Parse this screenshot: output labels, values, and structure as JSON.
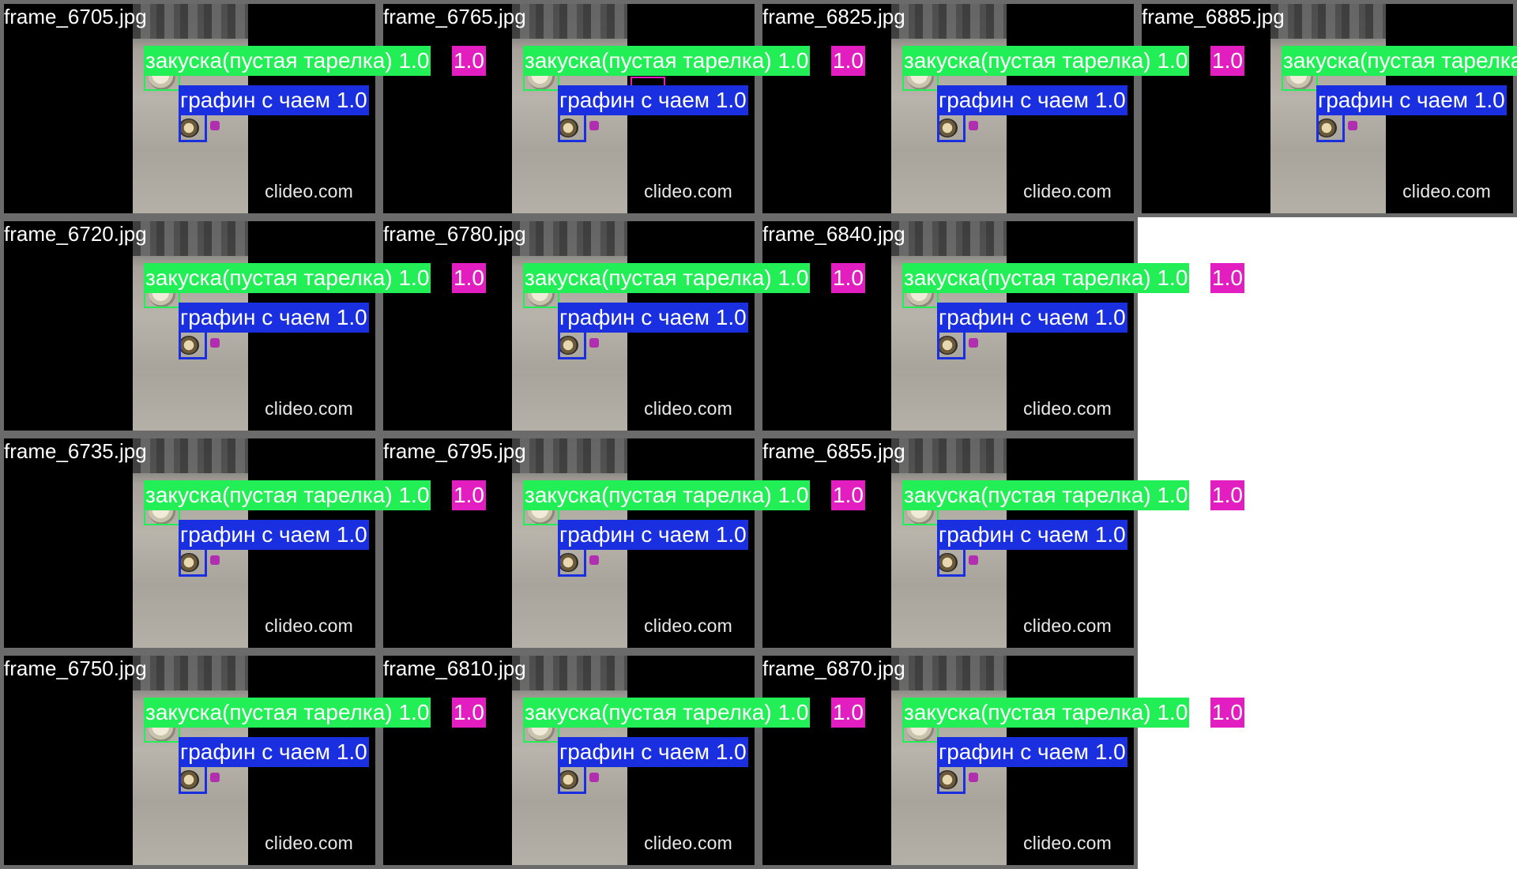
{
  "watermark": "clideo.com",
  "labels": {
    "green": "закуска(пустая тарелка) 1.0",
    "blue": "графин с чаем 1.0",
    "pink": "1.0"
  },
  "colors": {
    "green_box": "#22ee55",
    "blue_box": "#1a2fe0",
    "pink_box": "#e21ec0",
    "tile_border": "#6b6b6b"
  },
  "tiles": [
    {
      "name": "frame_6705.jpg",
      "col": 0,
      "row": 0,
      "pink_label": true
    },
    {
      "name": "frame_6720.jpg",
      "col": 0,
      "row": 1,
      "pink_label": true
    },
    {
      "name": "frame_6735.jpg",
      "col": 0,
      "row": 2,
      "pink_label": true
    },
    {
      "name": "frame_6750.jpg",
      "col": 0,
      "row": 3,
      "pink_label": true
    },
    {
      "name": "frame_6765.jpg",
      "col": 1,
      "row": 0,
      "pink_label": true,
      "pink_box": true
    },
    {
      "name": "frame_6780.jpg",
      "col": 1,
      "row": 1,
      "pink_label": true
    },
    {
      "name": "frame_6795.jpg",
      "col": 1,
      "row": 2,
      "pink_label": true
    },
    {
      "name": "frame_6810.jpg",
      "col": 1,
      "row": 3,
      "pink_label": true
    },
    {
      "name": "frame_6825.jpg",
      "col": 2,
      "row": 0,
      "pink_label": true
    },
    {
      "name": "frame_6840.jpg",
      "col": 2,
      "row": 1,
      "pink_label": true
    },
    {
      "name": "frame_6855.jpg",
      "col": 2,
      "row": 2,
      "pink_label": true
    },
    {
      "name": "frame_6870.jpg",
      "col": 2,
      "row": 3,
      "pink_label": true
    },
    {
      "name": "frame_6885.jpg",
      "col": 3,
      "row": 0,
      "pink_label": false
    }
  ]
}
